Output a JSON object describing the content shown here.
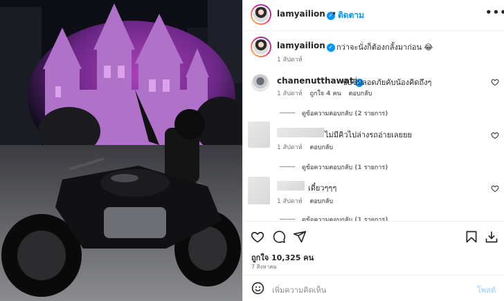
{
  "colors": {
    "accent": "#0095f6",
    "text": "#262626",
    "muted": "#737373",
    "post_disabled": "#b2dffc"
  },
  "header": {
    "username": "lamyailion",
    "separator": "•",
    "follow_label": "ติดตาม",
    "more_icon": "more-horizontal-icon"
  },
  "caption": {
    "username": "lamyailion",
    "text": "กว่าจะนั่งก็ต้องกลั้งมาก่อน 😂",
    "time": "1 สัปดาห์"
  },
  "comments": [
    {
      "username": "chanenutthawat",
      "text": "ขับขี่ปลอดภัยคับน้องคิดถึงๆ",
      "time": "1 สัปดาห์",
      "likes": "ถูกใจ 4 คน",
      "reply_label": "ตอบกลับ",
      "view_replies": "ดูข้อความตอบกลับ (2 รายการ)"
    },
    {
      "username": "",
      "text": "ไม่มีคิวไปล่างรถอ่ายเลยยย",
      "time": "1 สัปดาห์",
      "reply_label": "ตอบกลับ",
      "view_replies": "ดูข้อความตอบกลับ (1 รายการ)"
    },
    {
      "username": "",
      "text": "เดี๋ยวๆๆๆ",
      "time": "1 สัปดาห์",
      "reply_label": "ตอบกลับ",
      "view_replies": "ดูข้อความตอบกลับ (1 รายการ)"
    }
  ],
  "actions": {
    "like_icon": "heart-icon",
    "comment_icon": "comment-icon",
    "share_icon": "share-icon",
    "save_icon": "bookmark-icon",
    "download_icon": "download-icon"
  },
  "likes_text": "ถูกใจ 10,325 คน",
  "date": "7 สิงหาคม",
  "add_comment": {
    "emoji_icon": "emoji-icon",
    "placeholder": "เพิ่มความคิดเห็น",
    "post_label": "โพสต์"
  }
}
